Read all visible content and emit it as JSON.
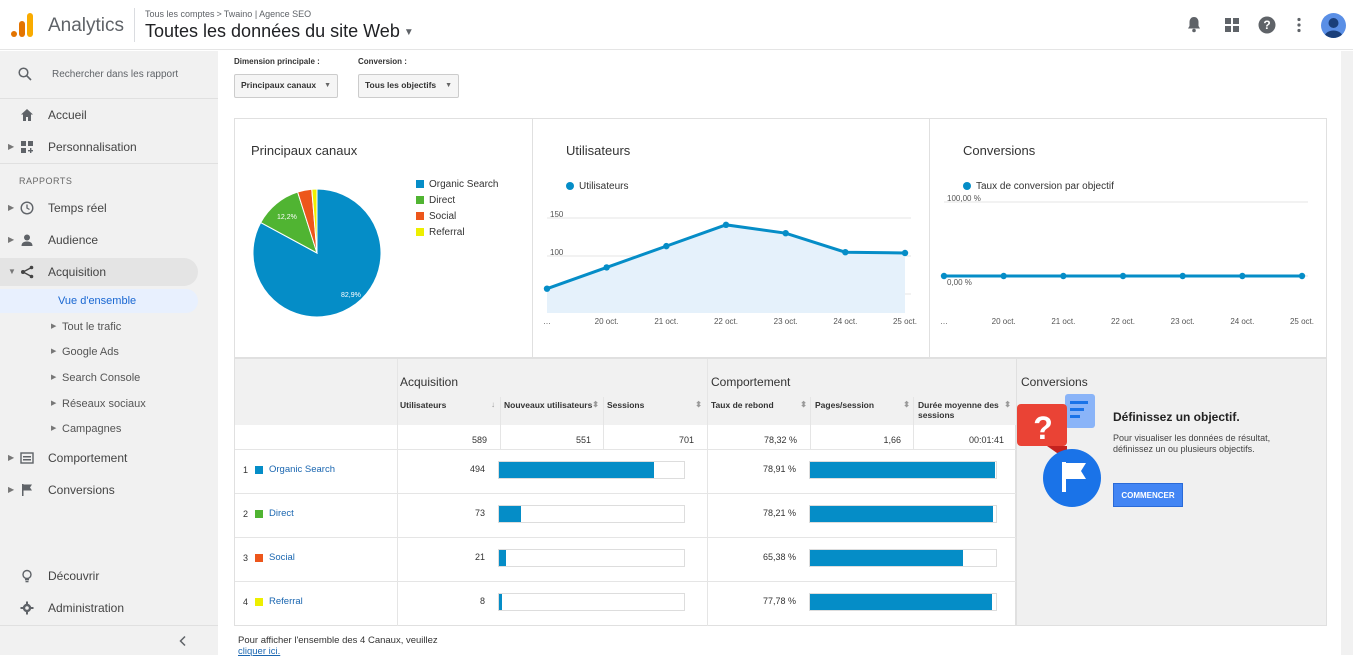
{
  "header": {
    "brand": "Analytics",
    "breadcrumb_account": "Tous les comptes",
    "breadcrumb_separator": ">",
    "breadcrumb_property": "Twaino | Agence SEO",
    "view_title": "Toutes les données du site Web",
    "icons": [
      "notifications-icon",
      "apps-icon",
      "help-icon",
      "more-vert-icon",
      "account-avatar"
    ]
  },
  "sidebar": {
    "search_placeholder": "Rechercher dans les rapport",
    "home": "Accueil",
    "customization": "Personnalisation",
    "reports_section": "RAPPORTS",
    "realtime": "Temps réel",
    "audience": "Audience",
    "acquisition": "Acquisition",
    "acquisition_children": [
      "Vue d'ensemble",
      "Tout le trafic",
      "Google Ads",
      "Search Console",
      "Réseaux sociaux",
      "Campagnes"
    ],
    "behavior": "Comportement",
    "conversions": "Conversions",
    "discover": "Découvrir",
    "admin": "Administration",
    "collapse_icon": "chevron-left-icon"
  },
  "controls": {
    "primary_dimension_label": "Dimension principale :",
    "primary_dimension_value": "Principaux canaux",
    "conversion_label": "Conversion :",
    "conversion_value": "Tous les objectifs"
  },
  "pie_panel": {
    "title": "Principaux canaux",
    "legend": [
      "Organic Search",
      "Direct",
      "Social",
      "Referral"
    ],
    "labels": [
      "82,9%",
      "12,2%"
    ]
  },
  "users_panel": {
    "title": "Utilisateurs",
    "legend": "Utilisateurs",
    "y_ticks": [
      "150",
      "100",
      "50"
    ],
    "x_ticks": [
      "…",
      "20 oct.",
      "21 oct.",
      "22 oct.",
      "23 oct.",
      "24 oct.",
      "25 oct."
    ]
  },
  "conversions_panel": {
    "title": "Conversions",
    "legend": "Taux de conversion par objectif",
    "y_ticks": [
      "100,00 %",
      "0,00 %"
    ],
    "x_ticks": [
      "…",
      "20 oct.",
      "21 oct.",
      "22 oct.",
      "23 oct.",
      "24 oct.",
      "25 oct."
    ]
  },
  "chart_data": [
    {
      "type": "pie",
      "title": "Principaux canaux",
      "categories": [
        "Organic Search",
        "Direct",
        "Social",
        "Referral"
      ],
      "values": [
        82.9,
        12.2,
        3.6,
        1.3
      ],
      "colors": [
        "#058dc7",
        "#50b432",
        "#ed561b",
        "#edef00"
      ],
      "legend_position": "right"
    },
    {
      "type": "area",
      "title": "Utilisateurs",
      "x": [
        "…",
        "20 oct.",
        "21 oct.",
        "22 oct.",
        "23 oct.",
        "24 oct.",
        "25 oct."
      ],
      "series": [
        {
          "name": "Utilisateurs",
          "values": [
            57,
            85,
            113,
            141,
            130,
            105,
            104
          ]
        }
      ],
      "ylim": [
        25,
        175
      ],
      "color": "#058dc7",
      "grid": true
    },
    {
      "type": "line",
      "title": "Conversions",
      "x": [
        "…",
        "20 oct.",
        "21 oct.",
        "22 oct.",
        "23 oct.",
        "24 oct.",
        "25 oct."
      ],
      "series": [
        {
          "name": "Taux de conversion par objectif",
          "values": [
            0,
            0,
            0,
            0,
            0,
            0,
            0
          ]
        }
      ],
      "ylim": [
        -50,
        100
      ],
      "color": "#058dc7",
      "grid": true
    }
  ],
  "table": {
    "group_acquisition": "Acquisition",
    "group_behavior": "Comportement",
    "group_conversions": "Conversions",
    "columns": {
      "users": "Utilisateurs",
      "new_users": "Nouveaux utilisateurs",
      "sessions": "Sessions",
      "bounce_rate": "Taux de rebond",
      "pages_session": "Pages/session",
      "avg_duration": "Durée moyenne des sessions"
    },
    "totals": {
      "users": "589",
      "new_users": "551",
      "sessions": "701",
      "bounce_rate": "78,32 %",
      "pages_session": "1,66",
      "avg_duration": "00:01:41"
    },
    "rows": [
      {
        "rank": "1",
        "channel": "Organic Search",
        "color": "#058dc7",
        "users": "494",
        "users_share": 0.84,
        "bounce": "78,91 %",
        "bounce_share": 0.79
      },
      {
        "rank": "2",
        "channel": "Direct",
        "color": "#50b432",
        "users": "73",
        "users_share": 0.12,
        "bounce": "78,21 %",
        "bounce_share": 0.782
      },
      {
        "rank": "3",
        "channel": "Social",
        "color": "#ed561b",
        "users": "21",
        "users_share": 0.036,
        "bounce": "65,38 %",
        "bounce_share": 0.654
      },
      {
        "rank": "4",
        "channel": "Referral",
        "color": "#edef00",
        "users": "8",
        "users_share": 0.014,
        "bounce": "77,78 %",
        "bounce_share": 0.778
      }
    ]
  },
  "conversion_goal": {
    "heading": "Définissez un objectif.",
    "text": "Pour visualiser les données de résultat, définissez un ou plusieurs objectifs.",
    "button": "COMMENCER"
  },
  "footnote": {
    "text": "Pour afficher l'ensemble des 4 Canaux, veuillez",
    "link": "cliquer ici."
  }
}
